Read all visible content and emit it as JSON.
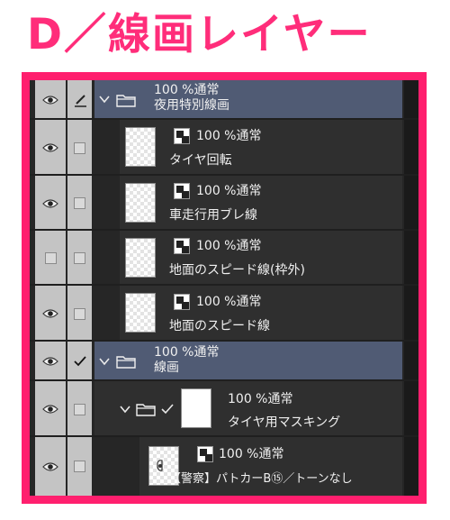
{
  "title": "D／線画レイヤー",
  "layers": {
    "folder1": {
      "blend": "100 %通常",
      "name": "夜用特別線画"
    },
    "layer1": {
      "blend": "100 %通常",
      "name": "タイヤ回転"
    },
    "layer2": {
      "blend": "100 %通常",
      "name": "車走行用ブレ線"
    },
    "layer3": {
      "blend": "100 %通常",
      "name": "地面のスピード線(枠外)"
    },
    "layer4": {
      "blend": "100 %通常",
      "name": "地面のスピード線"
    },
    "folder2": {
      "blend": "100 %通常",
      "name": "線画"
    },
    "mask_folder": {
      "blend": "100 %通常",
      "name": "タイヤ用マスキング"
    },
    "layer5": {
      "blend": "100 %通常",
      "name": "【警察】パトカーB⑮／トーンなし"
    }
  },
  "icons": {
    "eye": "eye-icon",
    "pen": "pen-icon",
    "folder": "folder-icon",
    "chevron": "chevron-down-icon",
    "check": "check-icon",
    "blend": "blend-mode-icon"
  },
  "colors": {
    "accent": "#ff1f6e",
    "folder_bar": "#505b74",
    "layer_bg": "#2f2f2f"
  }
}
